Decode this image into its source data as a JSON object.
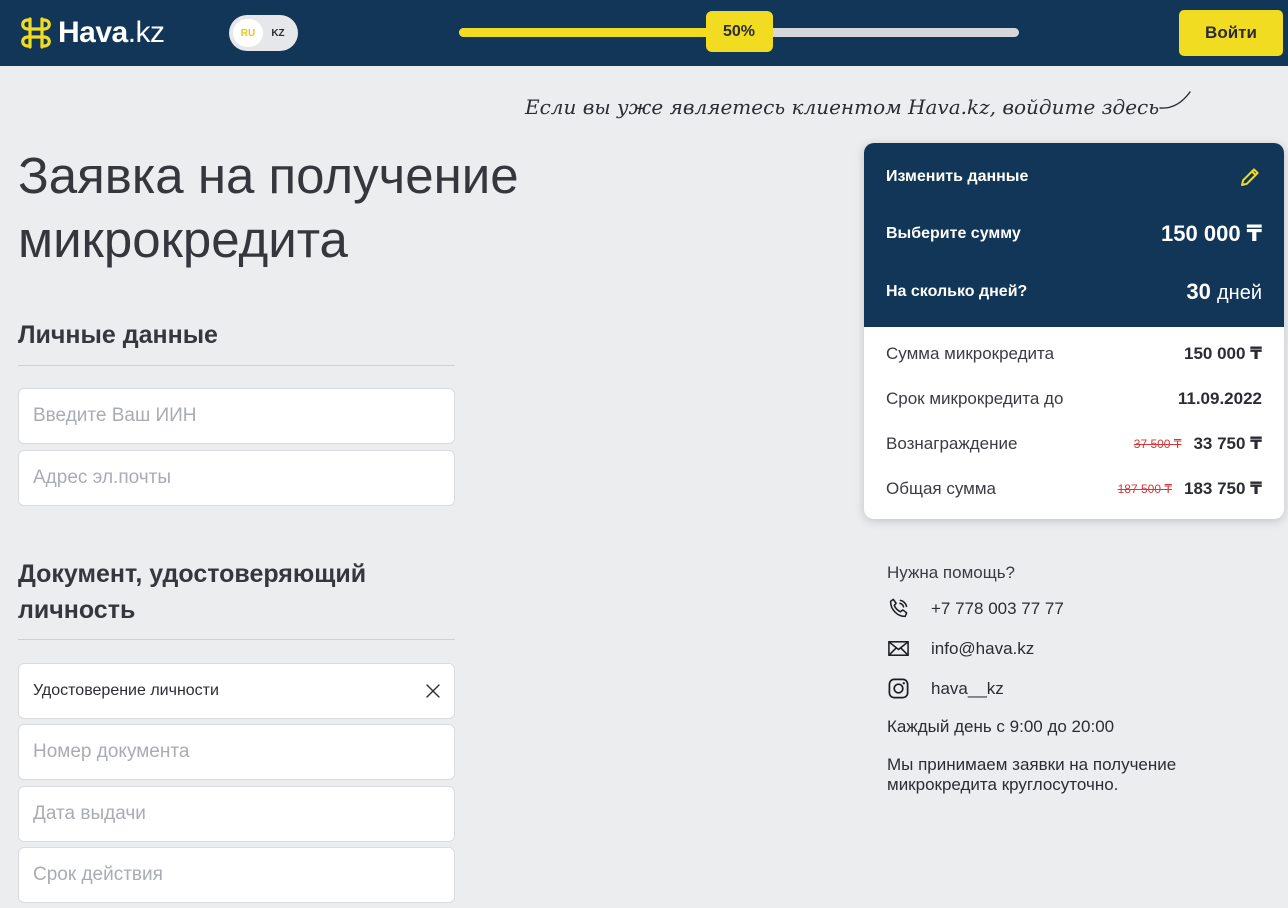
{
  "header": {
    "logo_text": "Hava",
    "logo_tld": ".kz",
    "lang_options": [
      "RU",
      "KZ"
    ],
    "lang_active": "RU",
    "progress_value": 50,
    "progress_label": "50%",
    "login_label": "Войти"
  },
  "client_hint": "Если вы уже являетесь клиентом Hava.kz, войдите здесь",
  "form": {
    "title": "Заявка на получение микрокредита",
    "personal_section": "Личные данные",
    "iin_placeholder": "Введите Ваш ИИН",
    "email_placeholder": "Адрес эл.почты",
    "document_section": "Документ, удостоверяющий личность",
    "document_type_value": "Удостоверение личности",
    "doc_number_placeholder": "Номер документа",
    "issue_date_placeholder": "Дата выдачи",
    "expiry_placeholder": "Срок действия"
  },
  "summary": {
    "edit_label": "Изменить данные",
    "amount_label": "Выберите сумму",
    "amount_value": "150 000 ₸",
    "days_label": "На сколько дней?",
    "days_value": "30",
    "days_unit": "дней",
    "rows": [
      {
        "label": "Сумма микрокредита",
        "old": "",
        "value": "150 000 ₸"
      },
      {
        "label": "Срок микрокредита до",
        "old": "",
        "value": "11.09.2022"
      },
      {
        "label": "Вознаграждение",
        "old": "37 500 ₸",
        "value": "33 750 ₸"
      },
      {
        "label": "Общая сумма",
        "old": "187 500 ₸",
        "value": "183 750 ₸"
      }
    ]
  },
  "help": {
    "title": "Нужна помощь?",
    "phone": "+7 778 003 77 77",
    "email": "info@hava.kz",
    "instagram": "hava__kz",
    "hours": "Каждый день с 9:00 до 20:00",
    "note": "Мы принимаем заявки на получение микрокредита круглосуточно."
  },
  "colors": {
    "navy": "#113657",
    "accent_yellow": "#f2dc21",
    "strike_red": "#d23a3a"
  },
  "icons": [
    "logo-mark-icon",
    "pencil-icon",
    "close-icon",
    "phone-icon",
    "mail-icon",
    "instagram-icon"
  ]
}
